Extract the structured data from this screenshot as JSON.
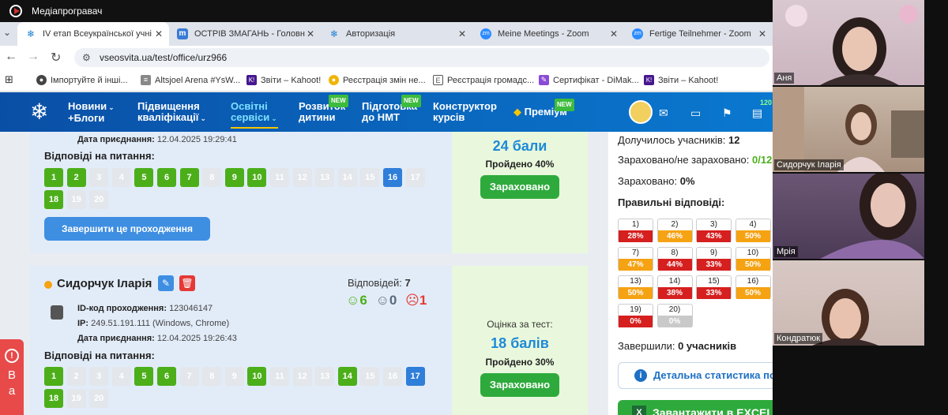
{
  "window": {
    "title": "Медіапрогравач"
  },
  "tabs": [
    {
      "label": "IV етап Всеукраїнської учні",
      "active": true
    },
    {
      "label": "ОСТРІВ ЗМАГАНЬ - Головн"
    },
    {
      "label": "Авторизація"
    },
    {
      "label": "Meine Meetings - Zoom"
    },
    {
      "label": "Fertige Teilnehmer - Zoom"
    }
  ],
  "address": {
    "url": "vseosvita.ua/test/office/urz966"
  },
  "bookmarks": [
    {
      "label": "Імпортуйте й інші..."
    },
    {
      "label": "Altsjoel Arena #YsW..."
    },
    {
      "label": "Звіти – Kahoot!",
      "icon": "K!"
    },
    {
      "label": "Реєстрація змін не..."
    },
    {
      "label": "Реєстрація громадс..."
    },
    {
      "label": "Сертифікат - DiMak..."
    },
    {
      "label": "Звіти – Kahoot!",
      "icon": "K!"
    }
  ],
  "sitenav": {
    "items": [
      {
        "l1": "Новини",
        "l2": "+Блоги"
      },
      {
        "l1": "Підвищення",
        "l2": "кваліфікації"
      },
      {
        "l1": "Освітні",
        "l2": "сервіси"
      },
      {
        "l1": "Розвиток",
        "l2": "дитини",
        "badge": "NEW"
      },
      {
        "l1": "Підготовка",
        "l2": "до НМТ",
        "badge": "NEW"
      },
      {
        "l1": "Конструктор",
        "l2": "курсів"
      },
      {
        "l1": "Преміум",
        "badge": "NEW"
      }
    ],
    "counter": "120"
  },
  "card1": {
    "date_label": "Дата приєднання:",
    "date": "12.04.2025 19:29:41",
    "answers_label": "Відповіді на питання:",
    "answers": [
      {
        "n": "1",
        "s": "g"
      },
      {
        "n": "2",
        "s": "g"
      },
      {
        "n": "3",
        "s": "x"
      },
      {
        "n": "4",
        "s": "x"
      },
      {
        "n": "5",
        "s": "g"
      },
      {
        "n": "6",
        "s": "g"
      },
      {
        "n": "7",
        "s": "g"
      },
      {
        "n": "8",
        "s": "x"
      },
      {
        "n": "9",
        "s": "g"
      },
      {
        "n": "10",
        "s": "g"
      },
      {
        "n": "11",
        "s": "x"
      },
      {
        "n": "12",
        "s": "x"
      },
      {
        "n": "13",
        "s": "x"
      },
      {
        "n": "14",
        "s": "x"
      },
      {
        "n": "15",
        "s": "x"
      },
      {
        "n": "16",
        "s": "b"
      },
      {
        "n": "17",
        "s": "x"
      },
      {
        "n": "18",
        "s": "g"
      },
      {
        "n": "19",
        "s": "x"
      },
      {
        "n": "20",
        "s": "x"
      }
    ],
    "finish_btn": "Завершити це проходження",
    "score": "24 бали",
    "passed": "Пройдено 40%",
    "status": "Зараховано"
  },
  "card2": {
    "name": "Сидорчук Іларія",
    "answers_count_label": "Відповідей:",
    "answers_count": "7",
    "good": "6",
    "neutral": "0",
    "bad": "1",
    "id_label": "ID-код проходження:",
    "id": "123046147",
    "ip_label": "IP:",
    "ip": "249.51.191.111 (Windows, Chrome)",
    "date_label": "Дата приєднання:",
    "date": "12.04.2025 19:26:43",
    "answers_label": "Відповіді на питання:",
    "answers": [
      {
        "n": "1",
        "s": "g"
      },
      {
        "n": "2",
        "s": "x"
      },
      {
        "n": "3",
        "s": "x"
      },
      {
        "n": "4",
        "s": "x"
      },
      {
        "n": "5",
        "s": "g"
      },
      {
        "n": "6",
        "s": "g"
      },
      {
        "n": "7",
        "s": "x"
      },
      {
        "n": "8",
        "s": "x"
      },
      {
        "n": "9",
        "s": "x"
      },
      {
        "n": "10",
        "s": "g"
      },
      {
        "n": "11",
        "s": "x"
      },
      {
        "n": "12",
        "s": "x"
      },
      {
        "n": "13",
        "s": "x"
      },
      {
        "n": "14",
        "s": "g"
      },
      {
        "n": "15",
        "s": "x"
      },
      {
        "n": "16",
        "s": "x"
      },
      {
        "n": "17",
        "s": "b"
      },
      {
        "n": "18",
        "s": "g"
      },
      {
        "n": "19",
        "s": "x"
      },
      {
        "n": "20",
        "s": "x"
      }
    ],
    "grade_label": "Оцінка за тест:",
    "score": "18 балів",
    "passed": "Пройдено 30%",
    "status": "Зараховано"
  },
  "stats": {
    "joined_label": "Долучилось учасників:",
    "joined": "12",
    "credited_label": "Зараховано/не зараховано:",
    "credited_val": "0/12",
    "credited2_label": "Зараховано:",
    "credited2": "0%",
    "correct_label": "Правильні відповіді:",
    "questions": [
      {
        "q": "1)",
        "p": "28%",
        "c": "r"
      },
      {
        "q": "2)",
        "p": "46%",
        "c": "o"
      },
      {
        "q": "3)",
        "p": "43%",
        "c": "r"
      },
      {
        "q": "4)",
        "p": "50%",
        "c": "o"
      },
      {
        "q": "7)",
        "p": "47%",
        "c": "o"
      },
      {
        "q": "8)",
        "p": "44%",
        "c": "r"
      },
      {
        "q": "9)",
        "p": "33%",
        "c": "r"
      },
      {
        "q": "10)",
        "p": "50%",
        "c": "o"
      },
      {
        "q": "13)",
        "p": "50%",
        "c": "o"
      },
      {
        "q": "14)",
        "p": "38%",
        "c": "r"
      },
      {
        "q": "15)",
        "p": "33%",
        "c": "r"
      },
      {
        "q": "16)",
        "p": "50%",
        "c": "o"
      },
      {
        "q": "19)",
        "p": "0%",
        "c": "r"
      },
      {
        "q": "20)",
        "p": "0%",
        "c": "gy"
      }
    ],
    "finished_label": "Завершили:",
    "finished": "0 учасників",
    "detail_btn": "Детальна статистика по відповідях",
    "export_btn": "Завантажити в EXCEL"
  },
  "video": {
    "participants": [
      "Аня",
      "Сидорчук Іларія",
      "Мрія",
      "Кондратюк"
    ]
  },
  "sidewidget": {
    "letters": "Ва"
  }
}
